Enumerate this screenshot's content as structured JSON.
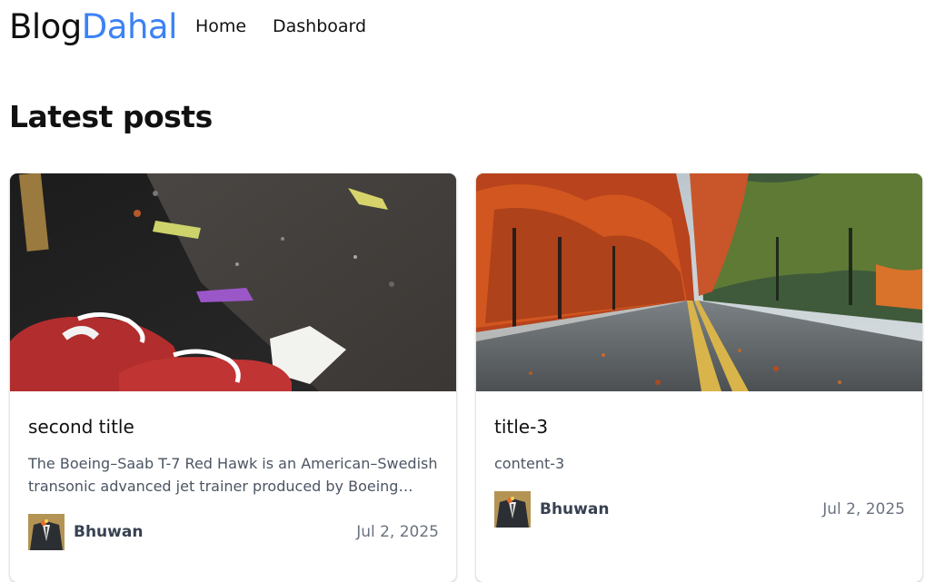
{
  "nav": {
    "logo_part1": "Blog",
    "logo_part2": "Dahal",
    "links": [
      "Home",
      "Dashboard"
    ]
  },
  "page": {
    "title": "Latest posts"
  },
  "posts": [
    {
      "title": "second title",
      "excerpt": "The Boeing–Saab T-7 Red Hawk is an American–Swedish transonic advanced jet trainer produced by Boeing with...",
      "author": "Bhuwan",
      "date": "Jul 2, 2025",
      "image": "red-sneakers-on-asphalt"
    },
    {
      "title": "title-3",
      "excerpt": "content-3",
      "author": "Bhuwan",
      "date": "Jul 2, 2025",
      "image": "autumn-tree-lined-road"
    }
  ],
  "colors": {
    "brand": "#3b82f6",
    "text": "#111111",
    "muted": "#6b7280"
  }
}
